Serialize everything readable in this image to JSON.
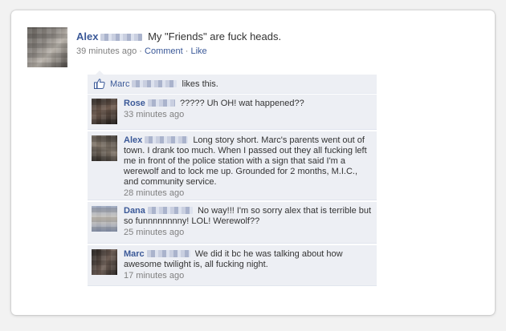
{
  "post": {
    "author": "Alex",
    "message": "My \"Friends\" are fuck heads.",
    "time": "39 minutes ago",
    "separator": "·",
    "comment_label": "Comment",
    "like_label": "Like"
  },
  "likes": {
    "name": "Marc",
    "text": "likes this."
  },
  "comments": [
    {
      "author": "Rose",
      "text": "????? Uh OH! wat happened??",
      "time": "33 minutes ago"
    },
    {
      "author": "Alex",
      "text": "Long story short. Marc's parents went out of town. I drank too much. When I passed out they all fucking left me in front of the police station with a sign that said I'm a werewolf and to lock me up. Grounded for 2 months, M.I.C., and community service.",
      "time": "28 minutes ago"
    },
    {
      "author": "Dana",
      "text": "No way!!! I'm so sorry alex that is terrible but so funnnnnnnny! LOL! Werewolf??",
      "time": "25 minutes ago"
    },
    {
      "author": "Marc",
      "text": "We did it bc he was talking about how awesome twilight is, all fucking night.",
      "time": "17 minutes ago"
    }
  ],
  "icons": {
    "like": "thumbs-up-icon"
  },
  "colors": {
    "link": "#3b5998",
    "comment_bg": "#edeff4",
    "meta": "#808080"
  }
}
